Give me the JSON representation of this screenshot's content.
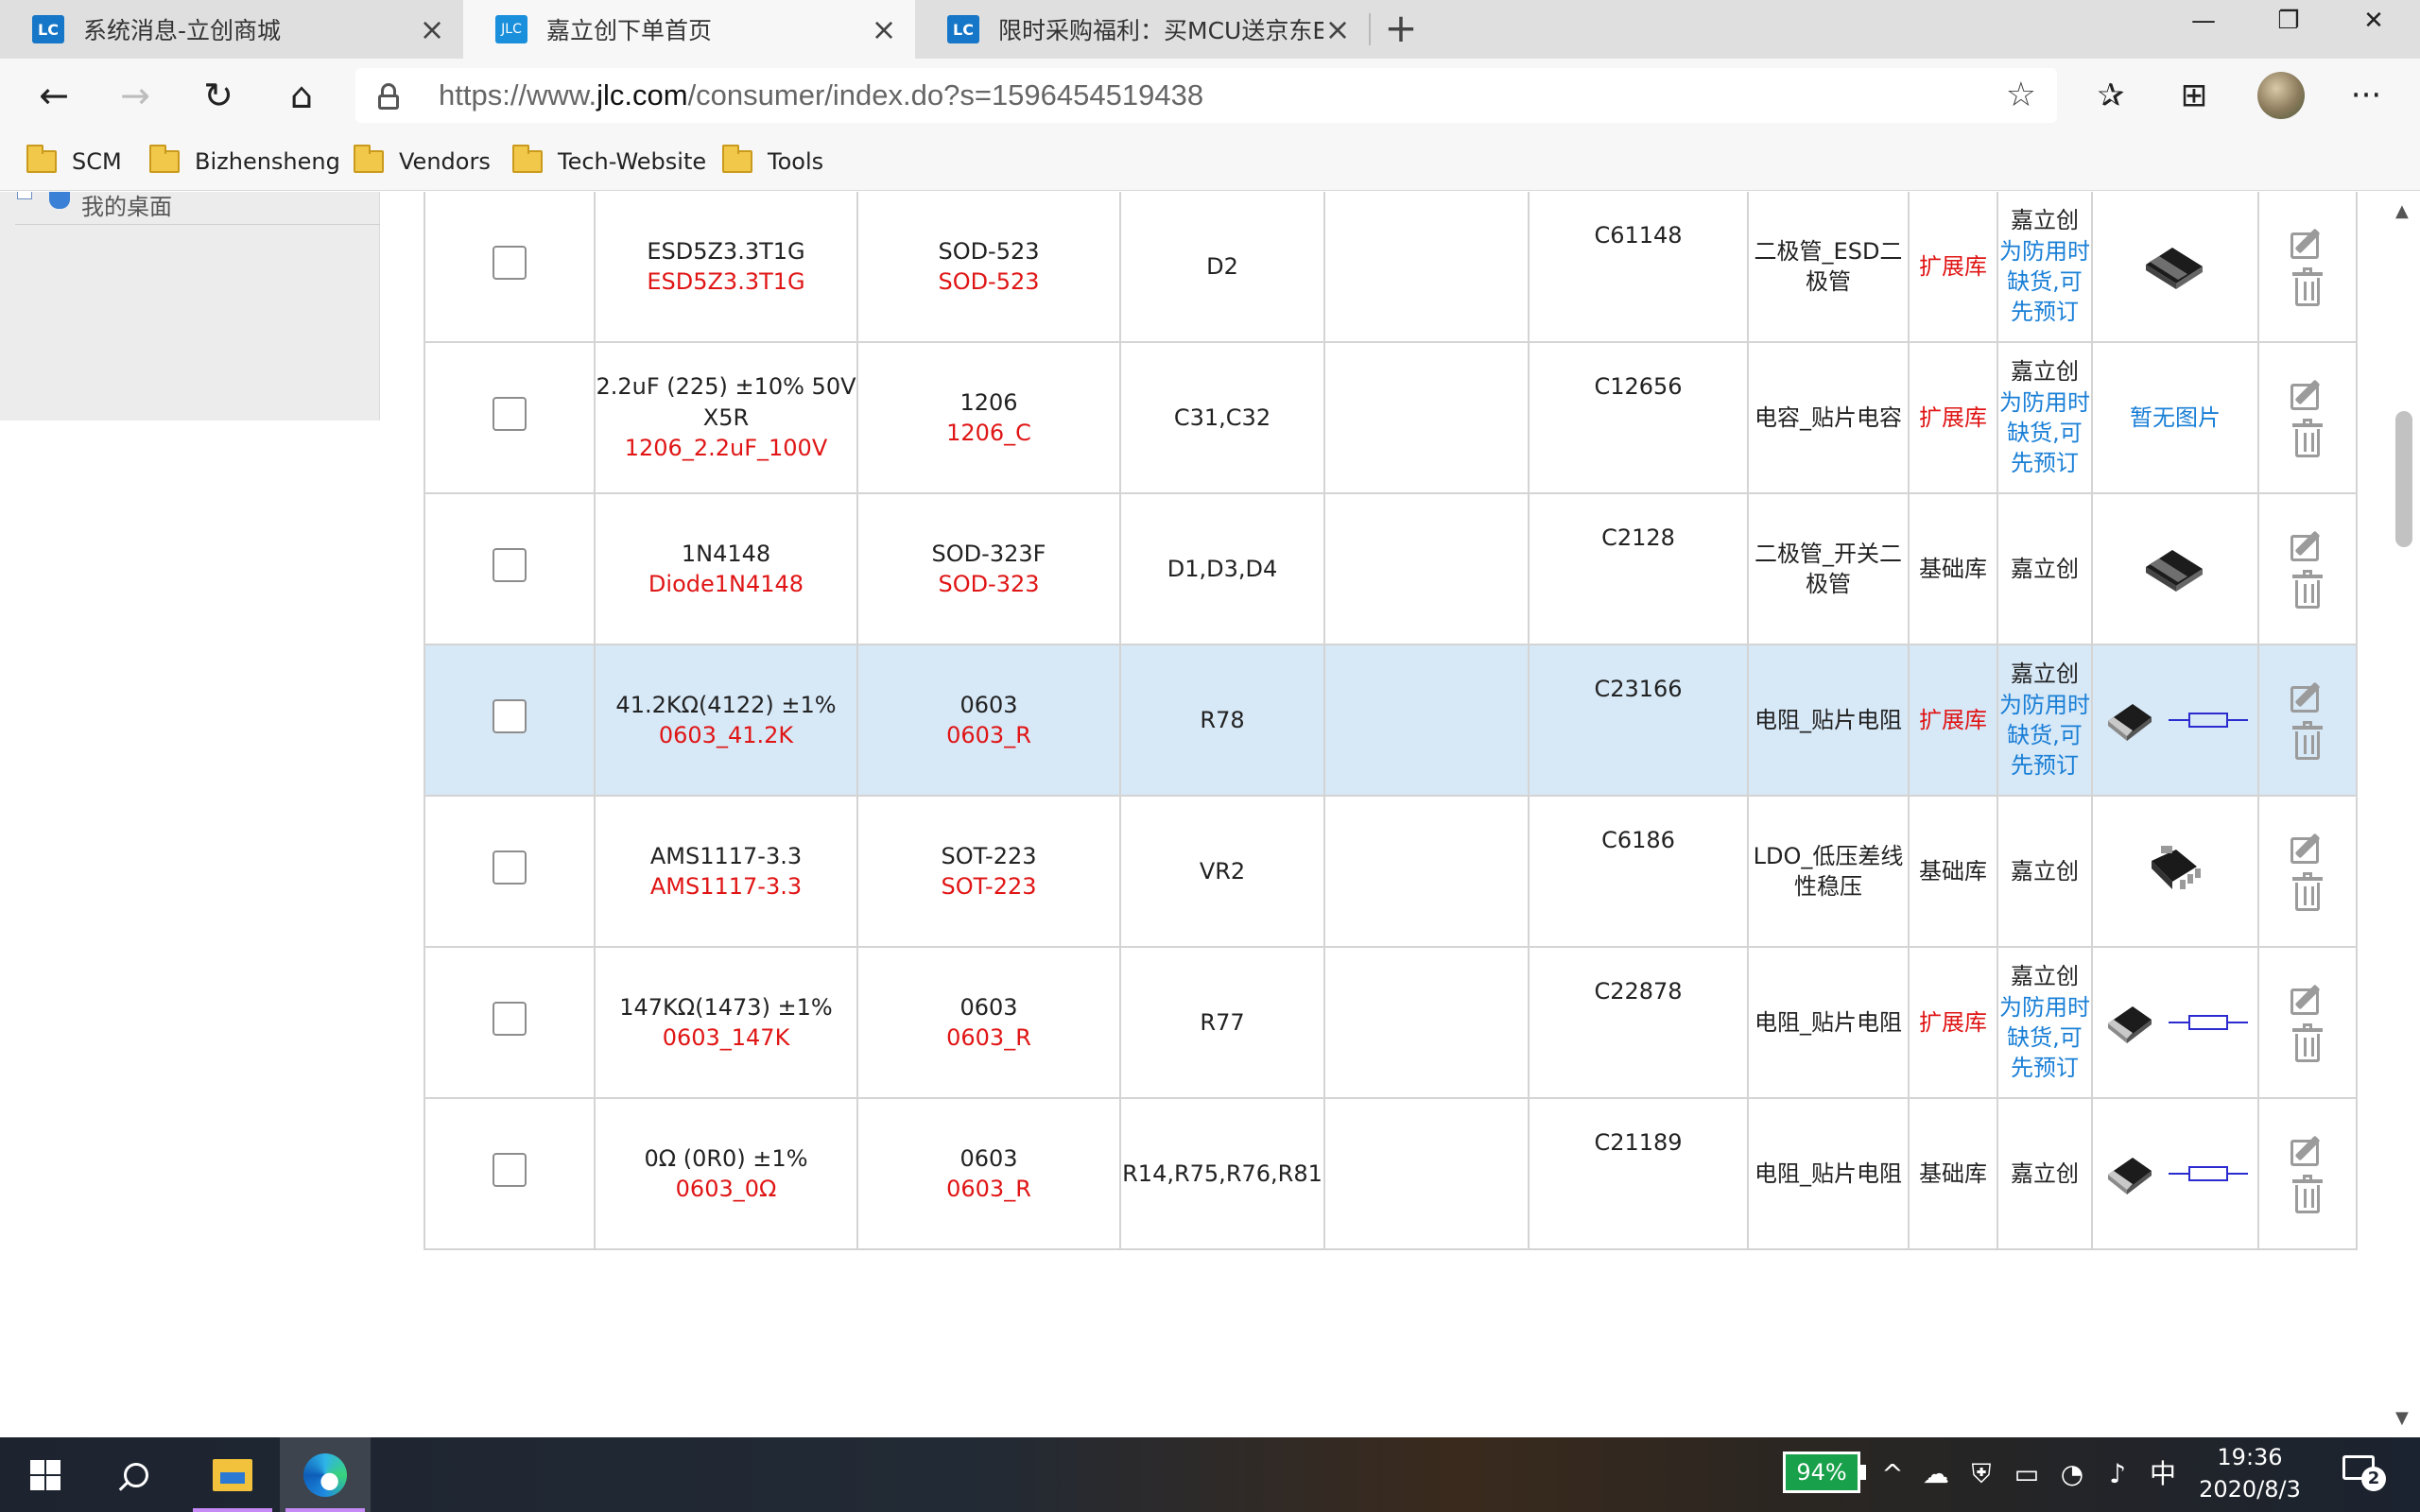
{
  "tabs": [
    {
      "favicon": "LC",
      "title": "系统消息-立创商城",
      "active": false
    },
    {
      "favicon": "JLC",
      "title": "嘉立创下单首页",
      "active": true
    },
    {
      "favicon": "LC",
      "title": "限时采购福利：买MCU送京东E卡",
      "active": false
    }
  ],
  "new_tab_label": "+",
  "window_controls": {
    "minimize": "—",
    "maximize": "❐",
    "close": "✕"
  },
  "toolbar": {
    "back": "←",
    "forward": "→",
    "refresh": "↻",
    "home": "⌂",
    "url_prefix": "https://www.",
    "url_domain": "jlc.com",
    "url_path": "/consumer/index.do?s=1596454519438",
    "favorite_star": "☆",
    "favorites": "✰",
    "collections": "⊞",
    "more": "···"
  },
  "bookmarks": [
    "SCM",
    "Bizhensheng",
    "Vendors",
    "Tech-Website",
    "Tools"
  ],
  "sidebar": {
    "desktop_label": "我的桌面"
  },
  "rows": [
    {
      "value": "ESD5Z3.3T1G",
      "value_red": "ESD5Z3.3T1G",
      "pkg": "SOD-523",
      "pkg_red": "SOD-523",
      "designator": "D2",
      "code": "C61148",
      "category": "二极管_ESD二极管",
      "library": "扩展库",
      "library_type": "ext",
      "supplier": "嘉立创",
      "notice": "为防用时缺货,可先预订",
      "image": "sod-pkg",
      "highlight": false
    },
    {
      "value": "2.2uF (225) ±10% 50V X5R",
      "value_red": "1206_2.2uF_100V",
      "pkg": "1206",
      "pkg_red": "1206_C",
      "designator": "C31,C32",
      "code": "C12656",
      "category": "电容_贴片电容",
      "library": "扩展库",
      "library_type": "ext",
      "supplier": "嘉立创",
      "notice": "为防用时缺货,可先预订",
      "image": "none",
      "no_image_text": "暂无图片",
      "highlight": false
    },
    {
      "value": "1N4148",
      "value_red": "Diode1N4148",
      "pkg": "SOD-323F",
      "pkg_red": "SOD-323",
      "designator": "D1,D3,D4",
      "code": "C2128",
      "category": "二极管_开关二极管",
      "library": "基础库",
      "library_type": "basic",
      "supplier": "嘉立创",
      "notice": "",
      "image": "sod-pkg",
      "highlight": false
    },
    {
      "value": "41.2KΩ(4122) ±1%",
      "value_red": "0603_41.2K",
      "pkg": "0603",
      "pkg_red": "0603_R",
      "designator": "R78",
      "code": "C23166",
      "category": "电阻_贴片电阻",
      "library": "扩展库",
      "library_type": "ext",
      "supplier": "嘉立创",
      "notice": "为防用时缺货,可先预订",
      "image": "resistor",
      "highlight": true
    },
    {
      "value": "AMS1117-3.3",
      "value_red": "AMS1117-3.3",
      "pkg": "SOT-223",
      "pkg_red": "SOT-223",
      "designator": "VR2",
      "code": "C6186",
      "category": "LDO_低压差线性稳压",
      "library": "基础库",
      "library_type": "basic",
      "supplier": "嘉立创",
      "notice": "",
      "image": "sot-pkg",
      "highlight": false
    },
    {
      "value": "147KΩ(1473) ±1%",
      "value_red": "0603_147K",
      "pkg": "0603",
      "pkg_red": "0603_R",
      "designator": "R77",
      "code": "C22878",
      "category": "电阻_贴片电阻",
      "library": "扩展库",
      "library_type": "ext",
      "supplier": "嘉立创",
      "notice": "为防用时缺货,可先预订",
      "image": "resistor",
      "highlight": false
    },
    {
      "value": "0Ω (0R0) ±1%",
      "value_red": "0603_0Ω",
      "pkg": "0603",
      "pkg_red": "0603_R",
      "designator": "R14,R75,R76,R81",
      "code": "C21189",
      "category": "电阻_贴片电阻",
      "library": "基础库",
      "library_type": "basic",
      "supplier": "嘉立创",
      "notice": "",
      "image": "resistor",
      "highlight": false
    }
  ],
  "colors": {
    "red": "#e01515",
    "blue": "#1a7fd6",
    "highlight_row": "#d7e8f7",
    "battery_green": "#19a04b"
  },
  "taskbar": {
    "battery_percent": "94%",
    "ime": "中",
    "time": "19:36",
    "date": "2020/8/3",
    "notification_count": "2"
  }
}
